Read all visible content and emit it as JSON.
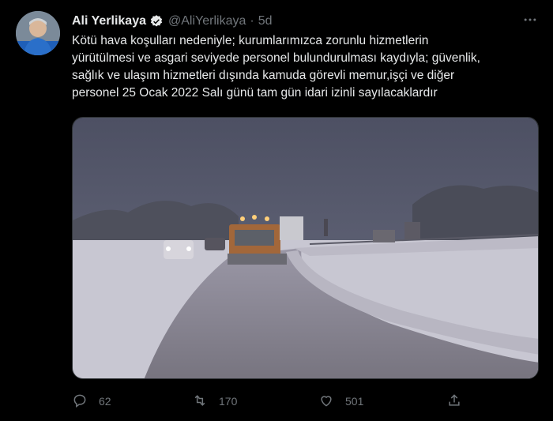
{
  "tweet": {
    "author_name": "Ali Yerlikaya",
    "author_handle": "@AliYerlikaya",
    "separator": "·",
    "time": "5d",
    "text": "Kötü hava koşulları nedeniyle; kurumlarımızca zorunlu hizmetlerin\nyürütülmesi ve asgari seviyede personel bulundurulması kaydıyla; güvenlik,\nsağlık ve ulaşım hizmetleri dışında kamuda görevli memur,işçi ve diğer\npersonel 25 Ocak 2022 Salı günü tam gün idari izinli sayılacaklardır",
    "verified_icon": "verified-badge-icon",
    "more_icon": "more-options-icon"
  },
  "actions": {
    "reply_count": "62",
    "retweet_count": "170",
    "like_count": "501"
  },
  "colors": {
    "background": "#000000",
    "primary_text": "#e7e9ea",
    "secondary_text": "#71767b",
    "verified": "#1d9bf0"
  }
}
